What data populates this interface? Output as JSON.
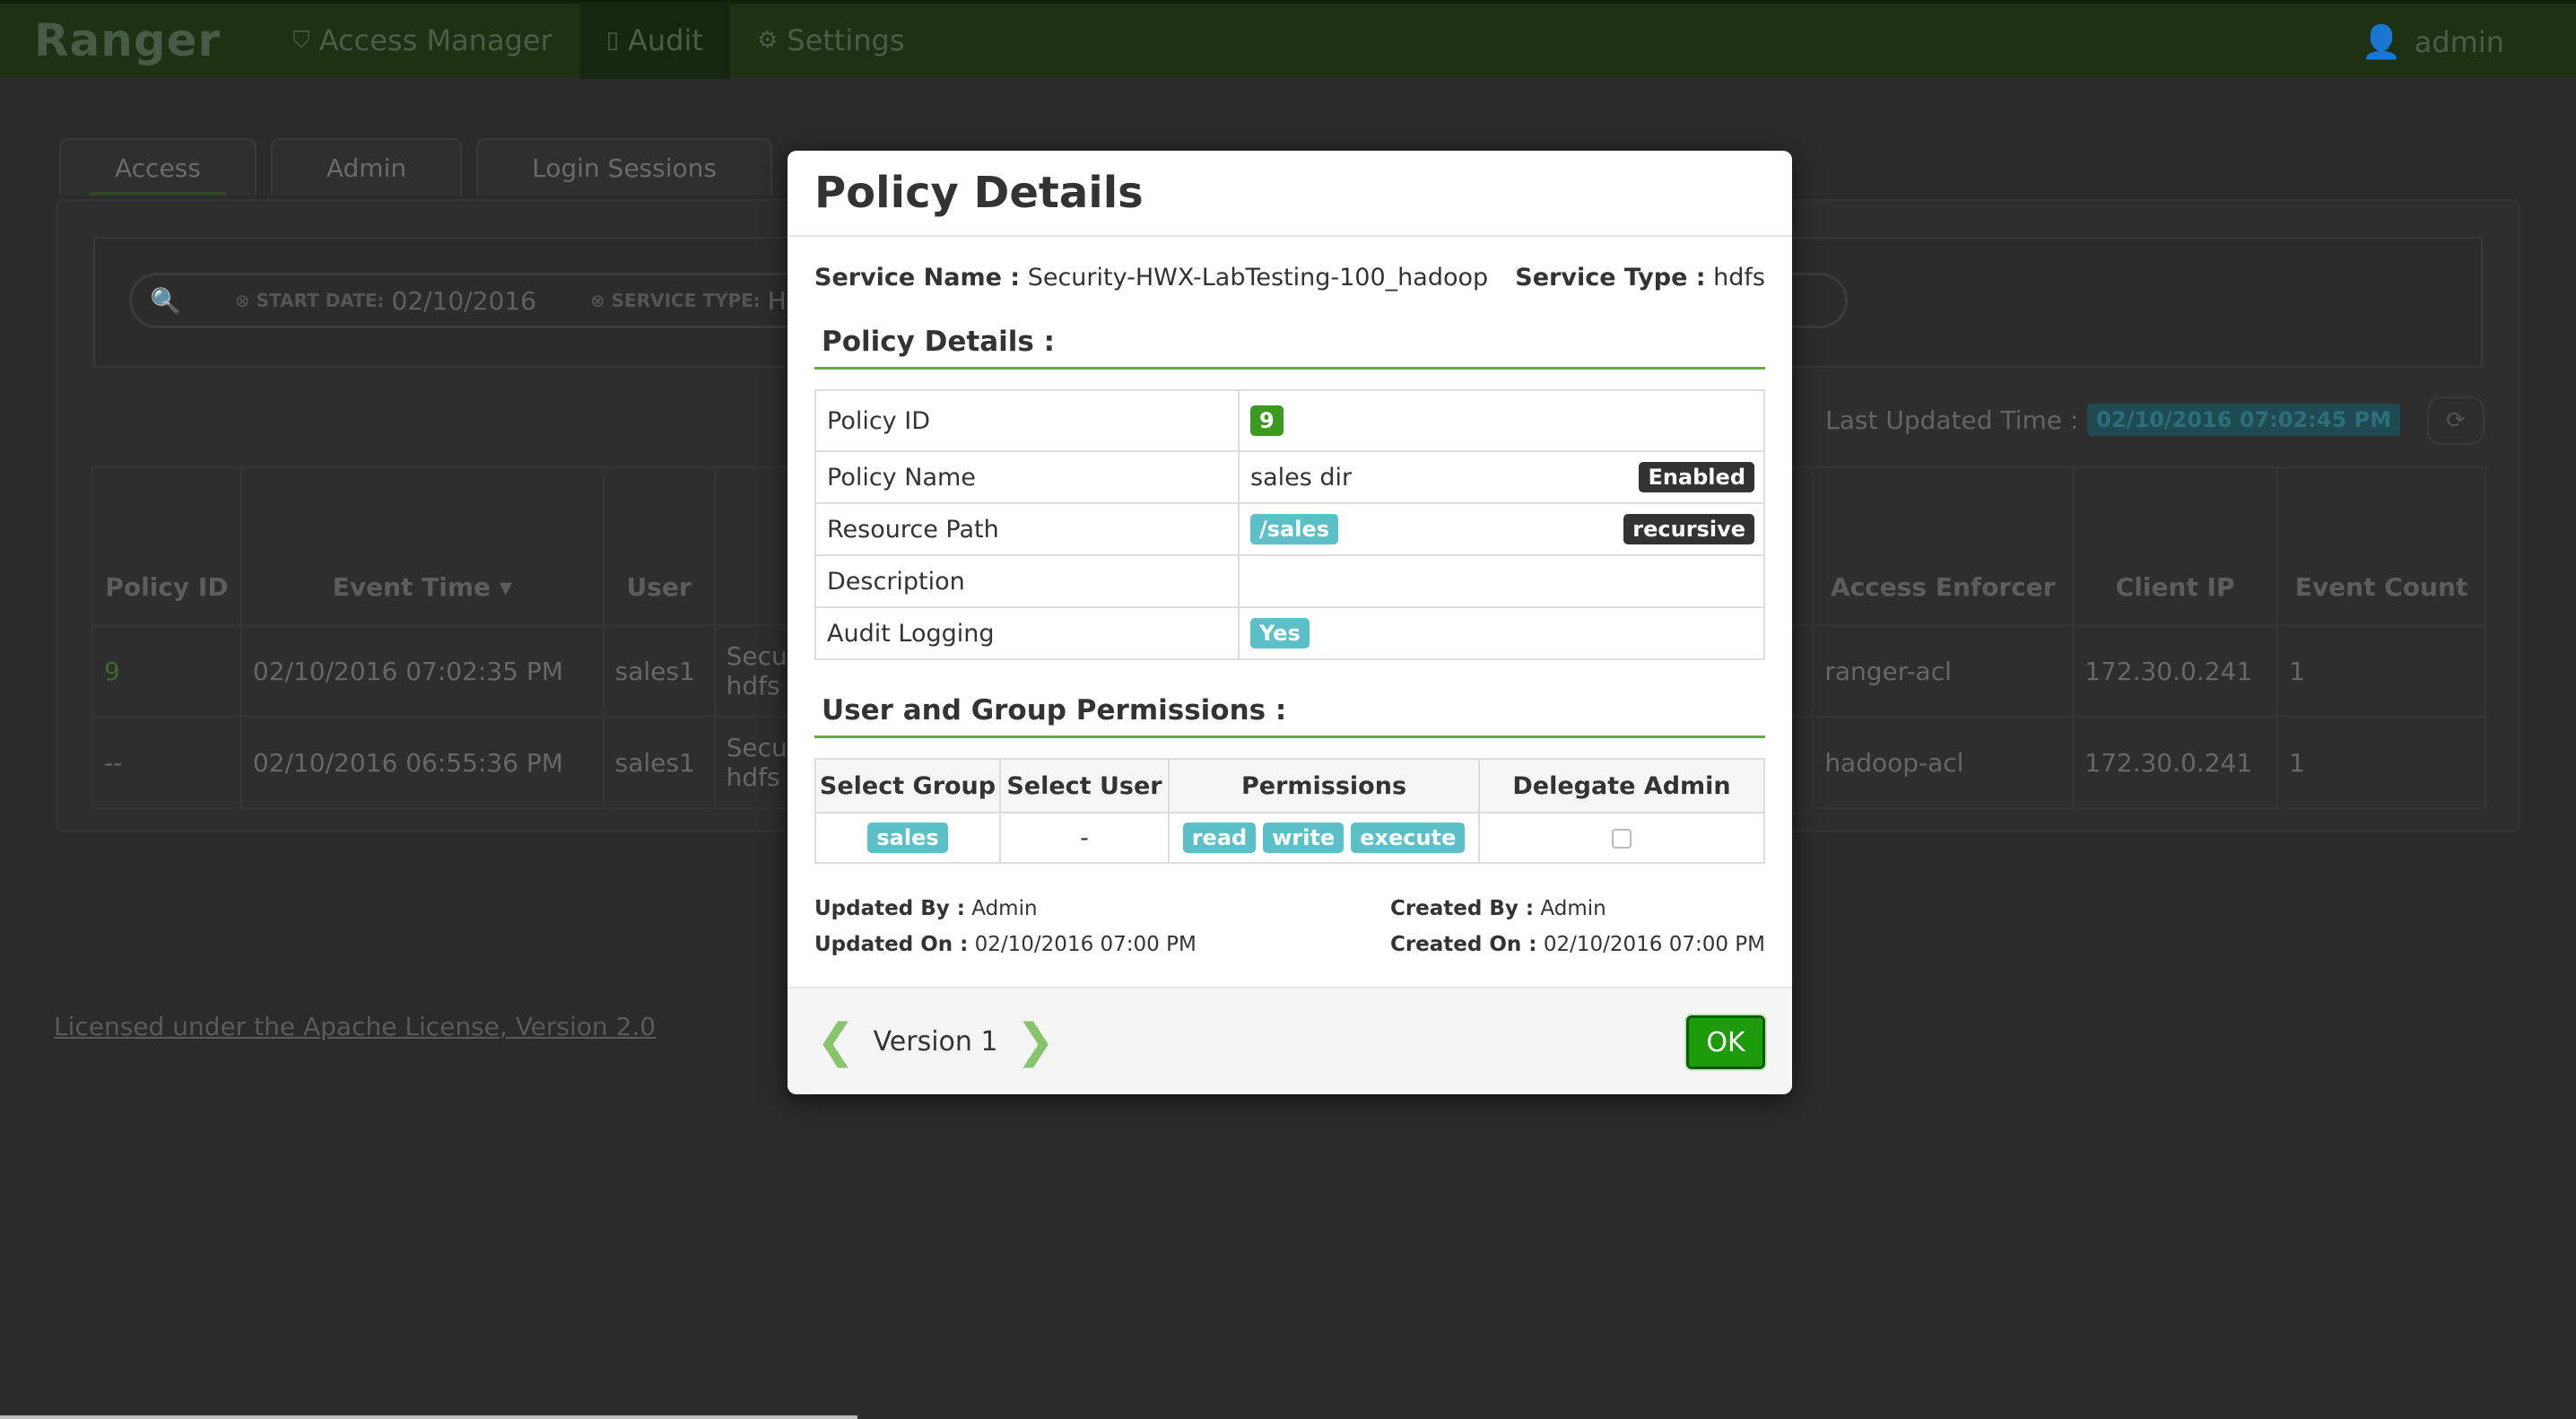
{
  "topbar": {
    "brand": "Ranger",
    "nav": [
      {
        "label": "Access Manager",
        "icon": "shield-icon"
      },
      {
        "label": "Audit",
        "icon": "document-icon"
      },
      {
        "label": "Settings",
        "icon": "gear-icon"
      }
    ],
    "user": "admin"
  },
  "tabs": [
    "Access",
    "Admin",
    "Login Sessions"
  ],
  "search": {
    "start_date_label": "START DATE:",
    "start_date_value": "02/10/2016",
    "service_type_label": "SERVICE TYPE:",
    "service_type_value": "HDFS"
  },
  "last_updated": {
    "label": "Last Updated Time :",
    "value": "02/10/2016 07:02:45 PM"
  },
  "grid": {
    "headers": [
      "Policy ID",
      "Event Time",
      "User",
      "",
      "Access Enforcer",
      "Client IP",
      "Event Count"
    ],
    "rows": [
      {
        "policy_id": "9",
        "event_time": "02/10/2016 07:02:35 PM",
        "user": "sales1",
        "service_line1": "Secur",
        "service_line2": "hdfs",
        "enforcer": "ranger-acl",
        "ip": "172.30.0.241",
        "count": "1"
      },
      {
        "policy_id": "--",
        "event_time": "02/10/2016 06:55:36 PM",
        "user": "sales1",
        "service_line1": "Secur",
        "service_line2": "hdfs",
        "enforcer": "hadoop-acl",
        "ip": "172.30.0.241",
        "count": "1"
      }
    ]
  },
  "license": "Licensed under the Apache License, Version 2.0",
  "modal": {
    "title": "Policy Details",
    "service_name_label": "Service Name :",
    "service_name": "Security-HWX-LabTesting-100_hadoop",
    "service_type_label": "Service Type :",
    "service_type": "hdfs",
    "section_details": "Policy Details :",
    "details": {
      "policy_id_label": "Policy ID",
      "policy_id": "9",
      "policy_name_label": "Policy Name",
      "policy_name": "sales dir",
      "status": "Enabled",
      "resource_path_label": "Resource Path",
      "resource_path": "/sales",
      "recursive": "recursive",
      "description_label": "Description",
      "description": "",
      "audit_logging_label": "Audit Logging",
      "audit_logging": "Yes"
    },
    "section_permissions": "User and Group Permissions :",
    "perm_headers": [
      "Select Group",
      "Select User",
      "Permissions",
      "Delegate Admin"
    ],
    "perm_row": {
      "group": "sales",
      "user": "-",
      "permissions": [
        "read",
        "write",
        "execute"
      ]
    },
    "updated_by_label": "Updated By :",
    "updated_by": "Admin",
    "updated_on_label": "Updated On :",
    "updated_on": "02/10/2016 07:00 PM",
    "created_by_label": "Created By :",
    "created_by": "Admin",
    "created_on_label": "Created On :",
    "created_on": "02/10/2016 07:00 PM",
    "version": "Version 1",
    "ok_label": "OK"
  }
}
